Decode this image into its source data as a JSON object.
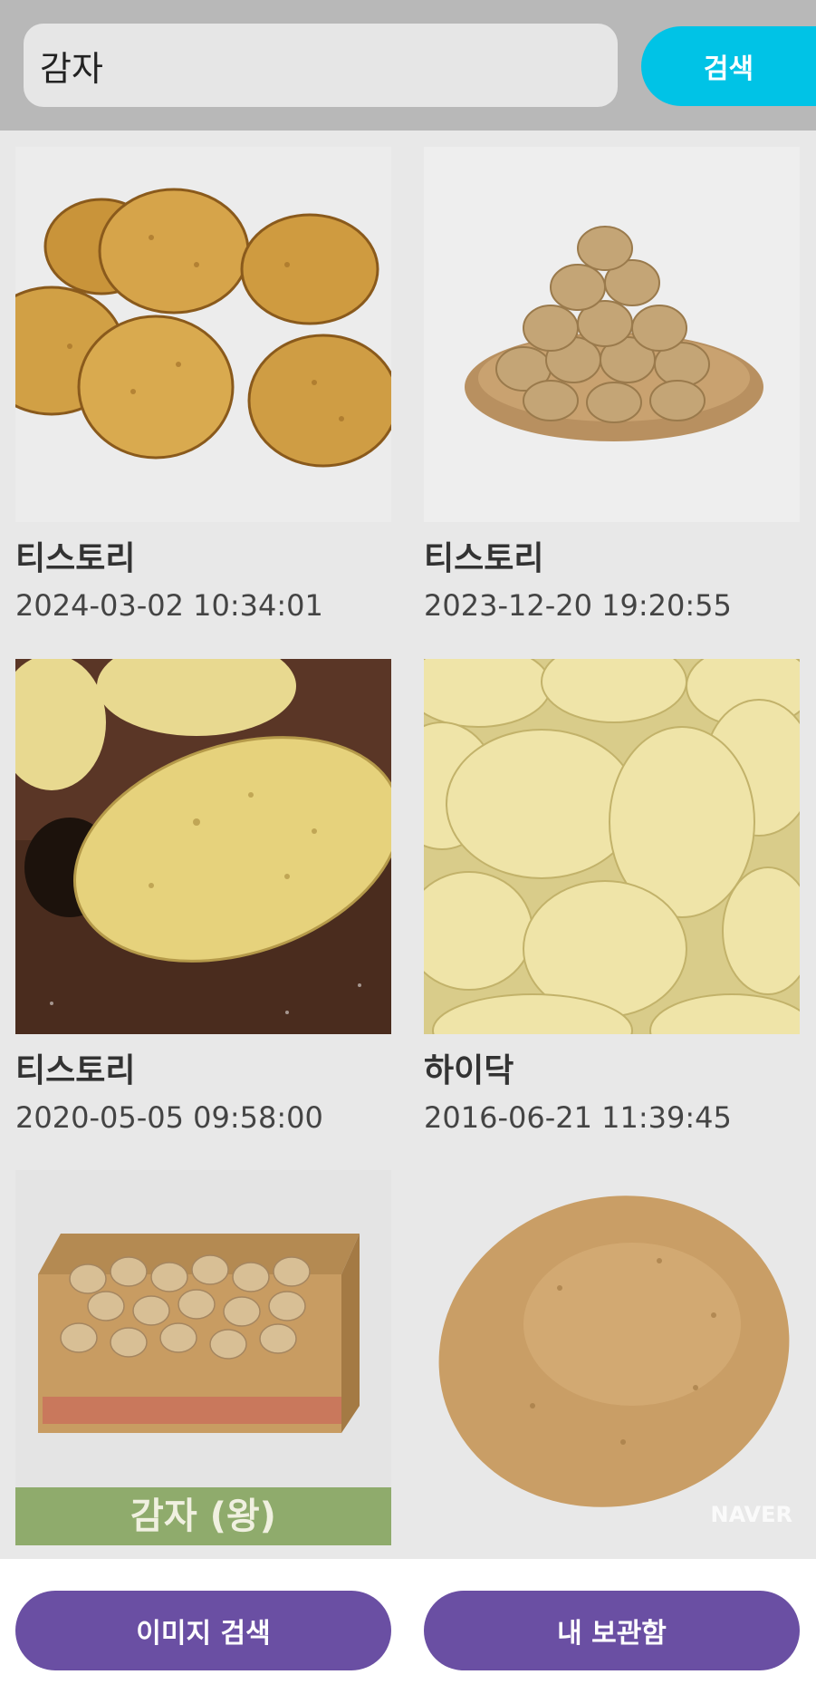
{
  "search": {
    "query": "감자",
    "button_label": "검색"
  },
  "results": [
    {
      "source": "티스토리",
      "date": "2024-03-02 10:34:01",
      "image": "potato-pile"
    },
    {
      "source": "티스토리",
      "date": "2023-12-20 19:20:55",
      "image": "potatoes-in-basket"
    },
    {
      "source": "티스토리",
      "date": "2020-05-05 09:58:00",
      "image": "potato-on-soil"
    },
    {
      "source": "하이닥",
      "date": "2016-06-21 11:39:45",
      "image": "potato-heap-closeup"
    },
    {
      "source": "",
      "date": "",
      "image": "potato-box",
      "label": "감자 (왕)"
    },
    {
      "source": "",
      "date": "",
      "image": "single-potato",
      "watermark": "NAVER"
    }
  ],
  "bottom": {
    "image_search_label": "이미지 검색",
    "my_storage_label": "내 보관함"
  },
  "colors": {
    "accent": "#00c3e6",
    "primary": "#6a4fa3",
    "topbar": "#b8b8b8",
    "background": "#e8e8e8"
  }
}
